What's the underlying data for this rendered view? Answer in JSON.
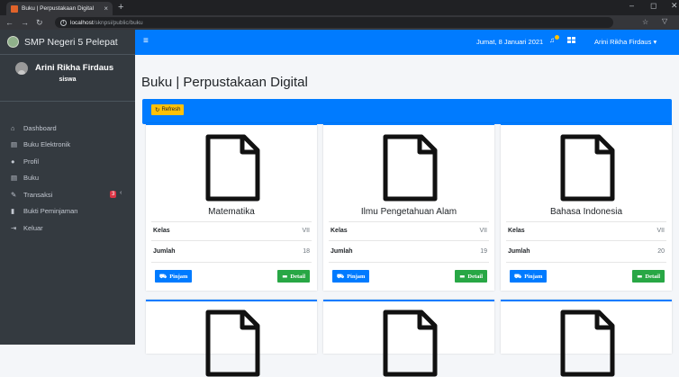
{
  "browser": {
    "tab_title": "Buku | Perpustakaan Digital",
    "tab_close": "×",
    "new_tab": "+",
    "url_host": "localhost",
    "url_path": "/sknpsi/public/buku",
    "minimize": "–",
    "maximize": "◻",
    "close": "✕"
  },
  "sidebar": {
    "brand": "SMP Negeri 5 Pelepat",
    "user_name": "Arini Rikha Firdaus",
    "user_role": "siswa",
    "items": [
      {
        "label": "Dashboard",
        "icon": "home-icon"
      },
      {
        "label": "Buku Elektronik",
        "icon": "book-icon"
      },
      {
        "label": "Profil",
        "icon": "user-icon"
      },
      {
        "label": "Buku",
        "icon": "book-icon"
      },
      {
        "label": "Transaksi",
        "icon": "pen-icon",
        "badge": "3"
      },
      {
        "label": "Bukti Peminjaman",
        "icon": "file-icon"
      },
      {
        "label": "Keluar",
        "icon": "sign-out-icon"
      }
    ]
  },
  "navbar": {
    "date": "Jumat, 8 Januari 2021",
    "user": "Arini Rikha Firdaus ▾"
  },
  "main": {
    "title": "Buku | Perpustakaan Digital",
    "refresh_label": "Refresh"
  },
  "books": [
    {
      "title": "Matematika",
      "kelas_label": "Kelas",
      "kelas": "VII",
      "jumlah_label": "Jumlah",
      "jumlah": "18",
      "pinjam": "Pinjam",
      "detail": "Detail"
    },
    {
      "title": "Ilmu Pengetahuan Alam",
      "kelas_label": "Kelas",
      "kelas": "VII",
      "jumlah_label": "Jumlah",
      "jumlah": "19",
      "pinjam": "Pinjam",
      "detail": "Detail"
    },
    {
      "title": "Bahasa Indonesia",
      "kelas_label": "Kelas",
      "kelas": "VII",
      "jumlah_label": "Jumlah",
      "jumlah": "20",
      "pinjam": "Pinjam",
      "detail": "Detail"
    }
  ],
  "colors": {
    "primary": "#007bff",
    "success": "#28a745",
    "warning": "#ffc107",
    "danger": "#dc3545",
    "sidebar": "#343a40"
  }
}
